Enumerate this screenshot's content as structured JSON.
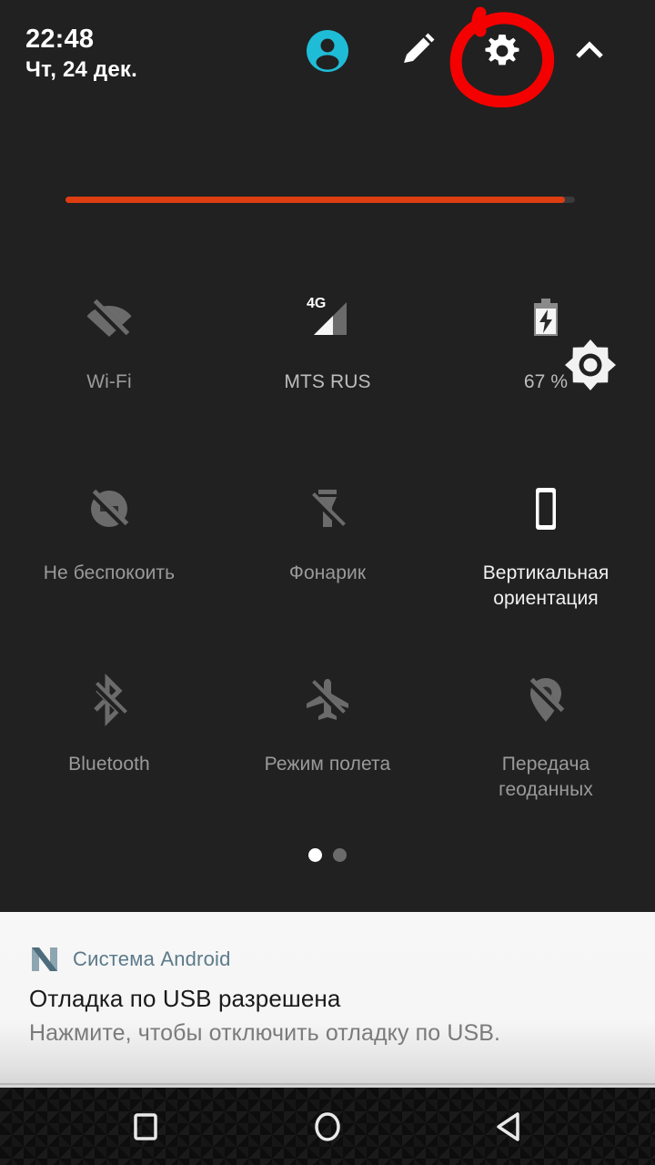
{
  "status": {
    "time": "22:48",
    "date": "Чт, 24 дек."
  },
  "header": {
    "avatar_icon": "user-avatar-icon",
    "edit_icon": "pencil-edit-icon",
    "settings_icon": "gear-settings-icon",
    "expand_icon": "chevron-up-icon",
    "annotation": {
      "shape": "hand-drawn-circle",
      "color": "#f50000",
      "target": "settings-button"
    }
  },
  "brightness": {
    "label": "brightness-slider",
    "value_percent": 98,
    "fill_color": "#dd3d10",
    "thumb_icon": "brightness-sun-icon"
  },
  "tiles": [
    {
      "id": "wifi",
      "label": "Wi-Fi",
      "icon": "wifi-off-icon",
      "state": "off"
    },
    {
      "id": "cellular",
      "label": "MTS RUS",
      "icon": "signal-4g-icon",
      "state": "info",
      "badge": "4G"
    },
    {
      "id": "battery",
      "label": "67 %",
      "icon": "battery-charging-icon",
      "state": "info"
    },
    {
      "id": "dnd",
      "label": "Не беспокоить",
      "icon": "do-not-disturb-off-icon",
      "state": "off"
    },
    {
      "id": "flashlight",
      "label": "Фонарик",
      "icon": "flashlight-off-icon",
      "state": "off"
    },
    {
      "id": "orientation",
      "label": "Вертикальная ориентация",
      "icon": "portrait-orientation-icon",
      "state": "on"
    },
    {
      "id": "bluetooth",
      "label": "Bluetooth",
      "icon": "bluetooth-off-icon",
      "state": "off"
    },
    {
      "id": "airplane",
      "label": "Режим полета",
      "icon": "airplane-off-icon",
      "state": "off"
    },
    {
      "id": "location",
      "label": "Передача геоданных",
      "icon": "location-off-icon",
      "state": "off"
    }
  ],
  "pages": {
    "count": 2,
    "active_index": 0
  },
  "notification": {
    "app_icon": "android-n-logo-icon",
    "app_name": "Система Android",
    "title": "Отладка по USB разрешена",
    "body": "Нажмите, чтобы отключить отладку по USB."
  },
  "navbar": {
    "recents_icon": "square-recents-icon",
    "home_icon": "circle-home-icon",
    "back_icon": "triangle-back-icon"
  },
  "colors": {
    "panel_background": "#212121",
    "avatar": "#1fbcd7",
    "brightness": "#dd3d10",
    "annotation": "#f50000",
    "notification_background": "#f7f7f7",
    "app_name": "#5c7a8a"
  }
}
